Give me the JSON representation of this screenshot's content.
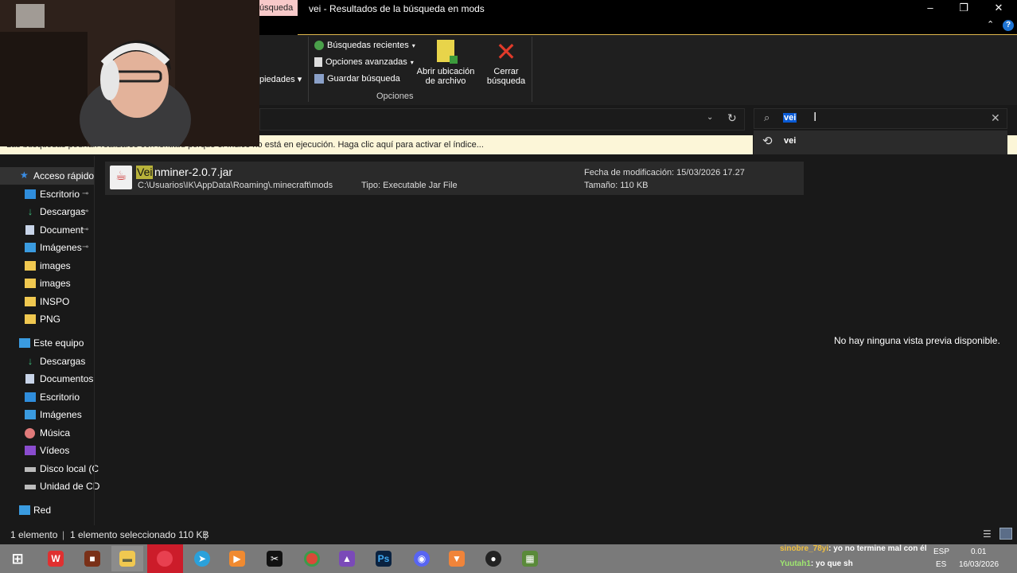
{
  "window": {
    "title": "vei - Resultados de la búsqueda en mods",
    "active_tab_label": "úsqueda",
    "minimize": "–",
    "maximize": "❐",
    "close": "✕"
  },
  "ribbon": {
    "properties_label": "piedades",
    "recent_searches": "Búsquedas recientes",
    "advanced_options": "Opciones avanzadas",
    "save_search": "Guardar búsqueda",
    "open_location_line1": "Abrir ubicación",
    "open_location_line2": "de archivo",
    "close_search_line1": "Cerrar",
    "close_search_line2": "búsqueda",
    "group_label": "Opciones"
  },
  "search": {
    "value": "vei",
    "suggestion": "vei"
  },
  "info_bar": {
    "text": "Las búsquedas podrían realizarse con lentitud porque el índice no está en ejecución. Haga clic aquí para activar el índice..."
  },
  "nav": {
    "quick_access": "Acceso rápido",
    "quick_items": [
      {
        "label": "Escritorio",
        "pinned": true,
        "icon": "desktop-icon"
      },
      {
        "label": "Descargas",
        "pinned": true,
        "icon": "download-icon"
      },
      {
        "label": "Document",
        "pinned": true,
        "icon": "document-icon"
      },
      {
        "label": "Imágenes",
        "pinned": true,
        "icon": "pictures-icon"
      },
      {
        "label": "images",
        "pinned": false,
        "icon": "folder-icon"
      },
      {
        "label": "images",
        "pinned": false,
        "icon": "folder-icon"
      },
      {
        "label": "INSPO",
        "pinned": false,
        "icon": "folder-icon"
      },
      {
        "label": "PNG",
        "pinned": false,
        "icon": "folder-icon"
      }
    ],
    "this_pc": "Este equipo",
    "pc_items": [
      {
        "label": "Descargas",
        "icon": "download-icon"
      },
      {
        "label": "Documentos",
        "icon": "document-icon"
      },
      {
        "label": "Escritorio",
        "icon": "desktop-icon"
      },
      {
        "label": "Imágenes",
        "icon": "pictures-icon"
      },
      {
        "label": "Música",
        "icon": "music-icon"
      },
      {
        "label": "Vídeos",
        "icon": "videos-icon"
      },
      {
        "label": "Disco local (C",
        "icon": "drive-icon"
      },
      {
        "label": "Unidad de CD",
        "icon": "cd-drive-icon"
      }
    ],
    "network": "Red",
    "pin_glyph": "📌"
  },
  "file": {
    "name_highlight": "Vei",
    "name_rest": "nminer-2.0.7.jar",
    "path": "C:\\Usuarios\\IK\\AppData\\Roaming\\.minecraft\\mods",
    "type": "Tipo:  Executable Jar File",
    "modified": "Fecha de modificación: 15/03/2026 17.27",
    "size": "Tamaño: 110 KB"
  },
  "preview": {
    "empty_text": "No hay ninguna vista previa disponible."
  },
  "status": {
    "count": "1 elemento",
    "selected": "1 elemento seleccionado  110 KB",
    "separator": "|"
  },
  "taskbar": {
    "chat": [
      {
        "user": "sinobre_78yi",
        "message": ": yo no termine mal con él"
      },
      {
        "user": "Yuutah1",
        "message": ": yo que sh"
      }
    ],
    "lang": "ESP",
    "lang_sub": "ES",
    "time": "0.01",
    "date": "16/03/2026",
    "apps": [
      "windows-start-icon",
      "wps-icon",
      "app-icon",
      "file-explorer-icon",
      "red-app-icon",
      "telegram-icon",
      "media-icon",
      "capcut-icon",
      "chrome-icon",
      "vs-icon",
      "photoshop-icon",
      "discord-icon",
      "brave-icon",
      "obs-icon",
      "minecraft-icon"
    ]
  },
  "colors": {
    "accent": "#0a5bd6",
    "info_bar_bg": "#fcf6d8",
    "highlight": "#b8b23a",
    "close_red": "#e03a2a"
  }
}
